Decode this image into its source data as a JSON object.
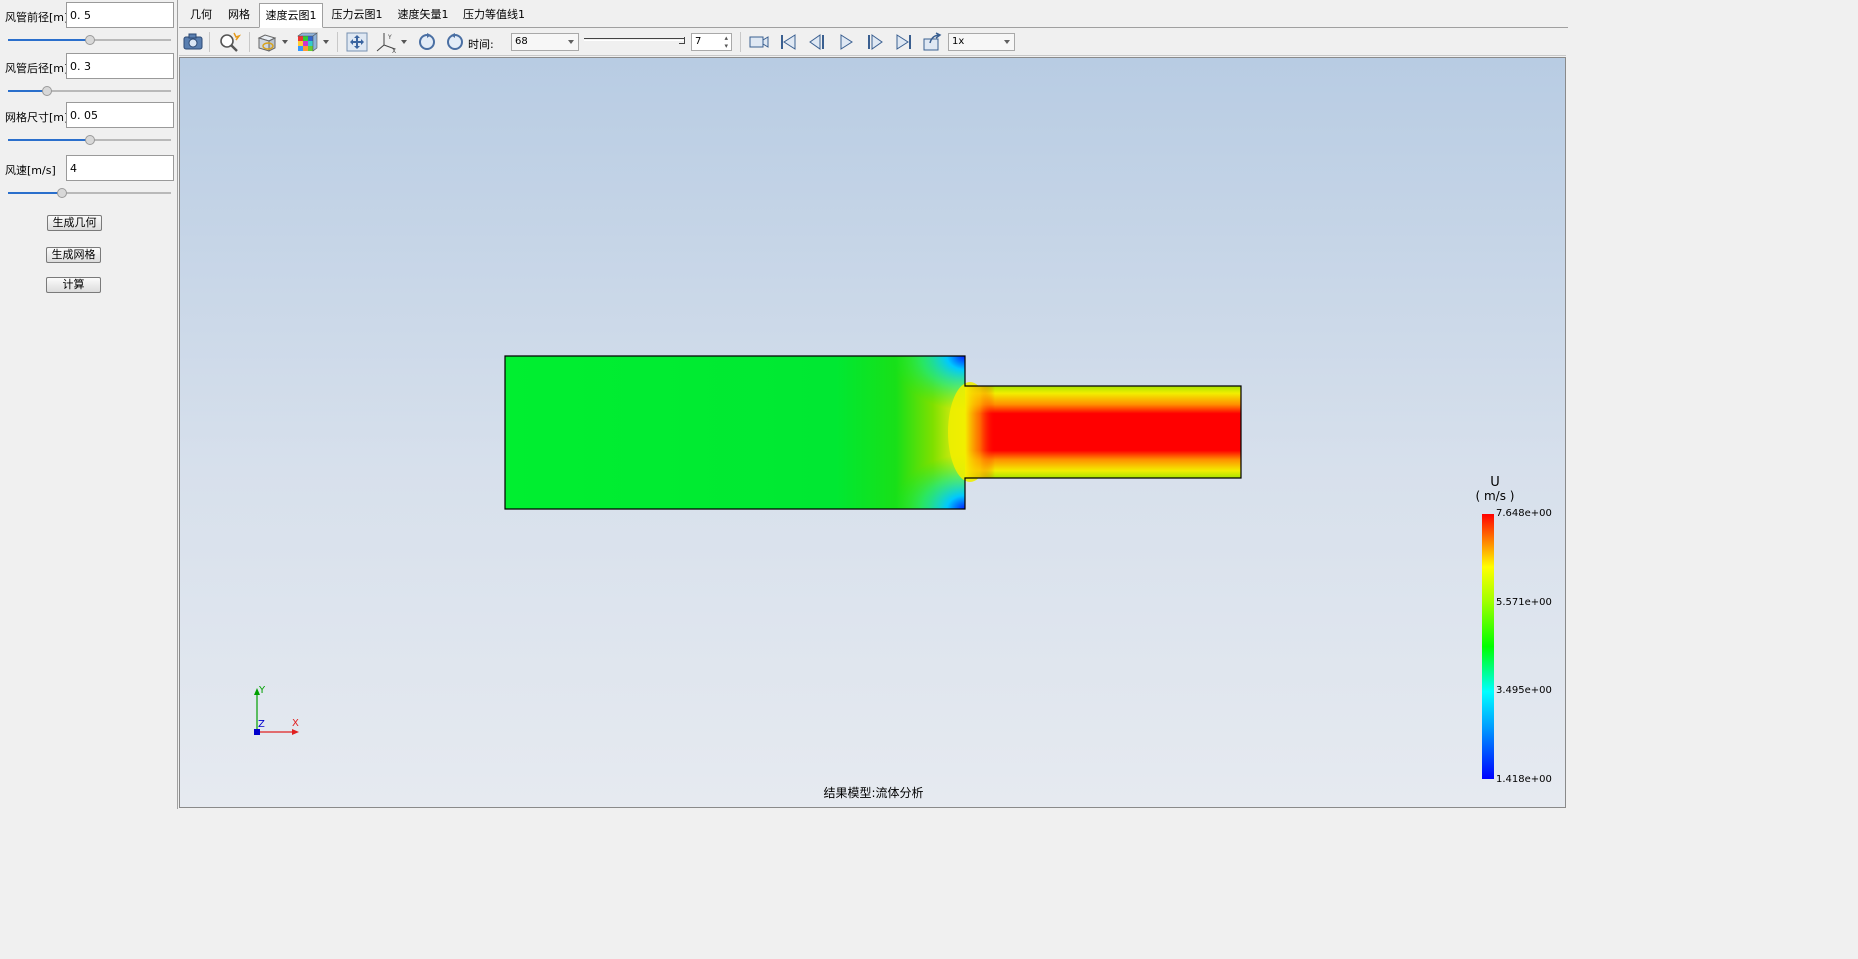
{
  "left_panel": {
    "params": [
      {
        "label": "风管前径[m]",
        "value": "0. 5",
        "slider_fraction": 0.5
      },
      {
        "label": "风管后径[m]",
        "value": "0. 3",
        "slider_fraction": 0.24
      },
      {
        "label": "网格尺寸[m]",
        "value": "0. 05",
        "slider_fraction": 0.5
      },
      {
        "label": "风速[m/s]",
        "value": "4",
        "slider_fraction": 0.33
      }
    ],
    "buttons": {
      "generate_geometry": "生成几何",
      "generate_mesh": "生成网格",
      "compute": "计算"
    }
  },
  "tabs": [
    {
      "label": "几何",
      "active": false
    },
    {
      "label": "网格",
      "active": false
    },
    {
      "label": "速度云图1",
      "active": true
    },
    {
      "label": "压力云图1",
      "active": false
    },
    {
      "label": "速度矢量1",
      "active": false
    },
    {
      "label": "压力等值线1",
      "active": false
    }
  ],
  "toolbar": {
    "time_label": "时间:",
    "time_value": "68",
    "frame_value": "7",
    "speed_value": "1x",
    "icons": [
      "camera-icon",
      "zoom-fit-icon",
      "clip-icon",
      "color-cube-icon",
      "pan-icon",
      "axes-icon",
      "rotate-cw-icon",
      "rotate-ccw-icon",
      "record-icon",
      "first-frame-icon",
      "prev-frame-icon",
      "play-icon",
      "next-frame-icon",
      "last-frame-icon",
      "export-icon"
    ]
  },
  "viewport": {
    "footer": "结果模型:流体分析",
    "axes": {
      "y": "Y",
      "z": "Z",
      "x": "X"
    },
    "colorbar": {
      "title": "U",
      "unit": "( m/s )",
      "ticks": [
        "7.648e+00",
        "5.571e+00",
        "3.495e+00",
        "1.418e+00"
      ],
      "min": 1.418,
      "max": 7.648
    }
  }
}
